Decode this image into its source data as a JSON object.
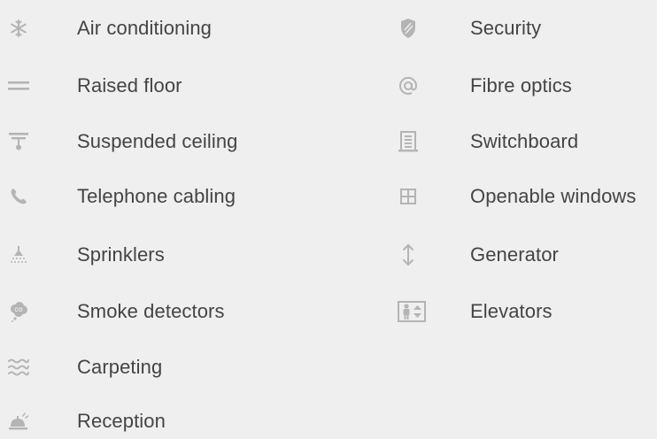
{
  "amenities": {
    "left": [
      {
        "label": "Air conditioning",
        "icon": "snowflake-icon"
      },
      {
        "label": "Raised floor",
        "icon": "equals-icon"
      },
      {
        "label": "Suspended ceiling",
        "icon": "ceiling-lamp-icon"
      },
      {
        "label": "Telephone cabling",
        "icon": "phone-icon"
      },
      {
        "label": "Sprinklers",
        "icon": "sprinkler-icon"
      },
      {
        "label": "Smoke detectors",
        "icon": "smoke-detector-icon"
      },
      {
        "label": "Carpeting",
        "icon": "waves-icon"
      },
      {
        "label": "Reception",
        "icon": "bell-icon"
      }
    ],
    "right": [
      {
        "label": "Security",
        "icon": "shield-icon"
      },
      {
        "label": "Fibre optics",
        "icon": "at-icon"
      },
      {
        "label": "Switchboard",
        "icon": "switchboard-icon"
      },
      {
        "label": "Openable windows",
        "icon": "window-icon"
      },
      {
        "label": "Generator",
        "icon": "up-down-arrow-icon"
      },
      {
        "label": "Elevators",
        "icon": "elevator-icon"
      }
    ]
  },
  "colors": {
    "background": "#efefef",
    "text": "#444444",
    "icon": "#b4b4b4"
  }
}
